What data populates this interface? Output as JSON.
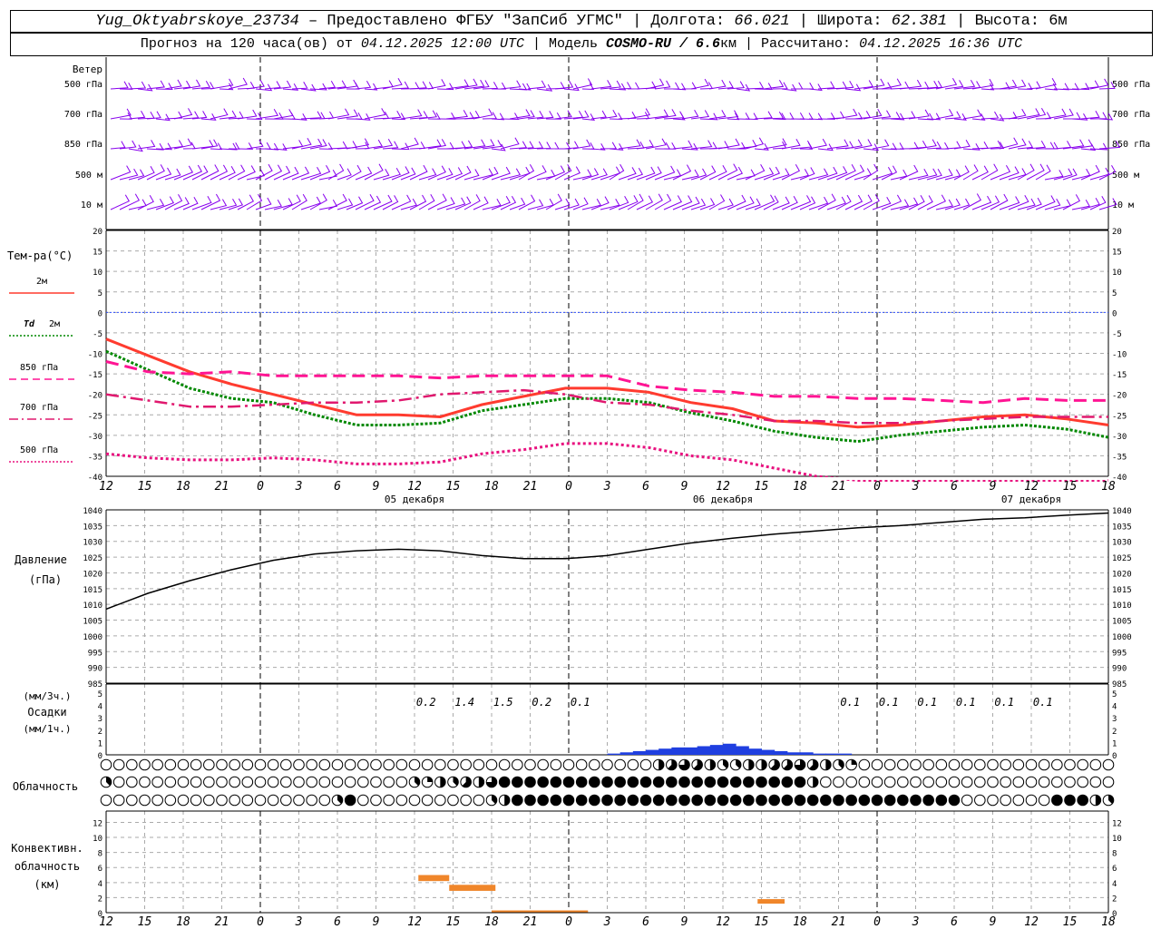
{
  "header": {
    "station": "Yug_Oktyabrskoye_23734",
    "dash": " – ",
    "provided": "Предоставлено ФГБУ \"ЗапСиб УГМС\"",
    "sep": " | ",
    "lon_label": "Долгота: ",
    "lon": "66.021",
    "lat_label": "Широта: ",
    "lat": "62.381",
    "alt_label": "Высота: ",
    "alt": "6м",
    "forecast_label": "Прогноз на 120 часа(ов) от ",
    "forecast_start": "04.12.2025 12:00 UTC",
    "model_label": "Модель ",
    "model": "COSMO-RU / 6.6",
    "model_unit": "км",
    "calc_label": "Рассчитано: ",
    "calc_time": "04.12.2025 16:36 UTC"
  },
  "colors": {
    "t2m": "#ff3b2f",
    "td2m": "#008800",
    "t850": "#ff1493",
    "t700": "#e0186e",
    "t500": "#e8117f",
    "wind": "#8800ee",
    "pressure": "#000000",
    "precip": "#1f3fe0",
    "convective": "#f0862a",
    "zero_line": "#3050ff"
  },
  "time_axis": {
    "hour_labels": [
      "12",
      "15",
      "18",
      "21",
      "0",
      "3",
      "6",
      "9",
      "12",
      "15",
      "18",
      "21",
      "0",
      "3",
      "6",
      "9",
      "12",
      "15",
      "18",
      "21",
      "0",
      "3",
      "6",
      "9",
      "12",
      "15",
      "18"
    ],
    "day_labels": [
      {
        "text": "05 декабря",
        "at_index": 8
      },
      {
        "text": "06 декабря",
        "at_index": 16
      },
      {
        "text": "07 декабря",
        "at_index": 24
      }
    ],
    "midnight_indices": [
      4,
      12,
      20
    ]
  },
  "wind_panel": {
    "title": "Ветер",
    "levels": [
      "500 гПа",
      "700 гПа",
      "850 гПа",
      "500 м",
      "10 м"
    ]
  },
  "temp_panel": {
    "title": "Тем-ра(°C)",
    "legend": [
      {
        "key": "t2m",
        "label": "2м",
        "style": "solid"
      },
      {
        "key": "td2m",
        "label_prefix": "Td",
        "label": "2м",
        "style": "dotted"
      },
      {
        "key": "t850",
        "label": "850 гПа",
        "style": "dashed"
      },
      {
        "key": "t700",
        "label": "700 гПа",
        "style": "dashdot"
      },
      {
        "key": "t500",
        "label": "500 гПа",
        "style": "dotted"
      }
    ],
    "yticks": [
      "20",
      "15",
      "10",
      "5",
      "0",
      "-5",
      "-10",
      "-15",
      "-20",
      "-25",
      "-30",
      "-35",
      "-40"
    ]
  },
  "pressure_panel": {
    "title1": "Давление",
    "title2": "(гПа)",
    "yticks": [
      "1040",
      "1035",
      "1030",
      "1025",
      "1020",
      "1015",
      "1010",
      "1005",
      "1000",
      "995",
      "990",
      "985"
    ]
  },
  "precip_panel": {
    "unit1": "(мм/3ч.)",
    "title": "Осадки",
    "unit2": "(мм/1ч.)",
    "yticks": [
      "5",
      "4",
      "3",
      "2",
      "1",
      "0"
    ],
    "labels": [
      {
        "text": "0.2",
        "at_index": 8.3
      },
      {
        "text": "1.4",
        "at_index": 9.3
      },
      {
        "text": "1.5",
        "at_index": 10.3
      },
      {
        "text": "0.2",
        "at_index": 11.3
      },
      {
        "text": "0.1",
        "at_index": 12.3
      },
      {
        "text": "0.1",
        "at_index": 19.3
      },
      {
        "text": "0.1",
        "at_index": 20.3
      },
      {
        "text": "0.1",
        "at_index": 21.3
      },
      {
        "text": "0.1",
        "at_index": 22.3
      },
      {
        "text": "0.1",
        "at_index": 23.3
      },
      {
        "text": "0.1",
        "at_index": 24.3
      }
    ]
  },
  "cloud_panel": {
    "title": "Облачность"
  },
  "conv_panel": {
    "title1": "Конвективн.",
    "title2": "облачность",
    "title3": "(км)",
    "yticks": [
      "12",
      "10",
      "8",
      "6",
      "4",
      "2",
      "0"
    ]
  },
  "chart_data": {
    "type": "line",
    "x_step_hours": 3,
    "x_start": "04.12.2025 12 UTC",
    "temperature_ylim": [
      -40,
      20
    ],
    "series": [
      {
        "key": "t2m",
        "values": [
          -6.5,
          -10.5,
          -14.5,
          -17.5,
          -20,
          -22.5,
          -25,
          -25,
          -25.5,
          -22.5,
          -20.5,
          -18.5,
          -18.5,
          -19.5,
          -22,
          -23.5,
          -26.5,
          -27,
          -28,
          -27.5,
          -26.5,
          -25.5,
          -25,
          -26,
          -27.5
        ]
      },
      {
        "key": "td2m",
        "values": [
          -9.5,
          -14,
          -18.5,
          -21,
          -22,
          -25,
          -27.5,
          -27.5,
          -27,
          -24,
          -22.5,
          -21,
          -21,
          -22,
          -24.5,
          -26.5,
          -29,
          -30.5,
          -31.5,
          -30,
          -29,
          -28,
          -27.5,
          -28.5,
          -30.5
        ]
      },
      {
        "key": "t850",
        "values": [
          -12,
          -14.5,
          -15,
          -14.5,
          -15.5,
          -15.5,
          -15.5,
          -15.5,
          -16,
          -15.5,
          -15.5,
          -15.5,
          -15.5,
          -18,
          -19,
          -19.5,
          -20.5,
          -20.5,
          -21,
          -21,
          -21.5,
          -22,
          -21,
          -21.5,
          -21.5
        ]
      },
      {
        "key": "t700",
        "values": [
          -20,
          -21.5,
          -23,
          -23,
          -22.5,
          -22,
          -22,
          -21.5,
          -20,
          -19.5,
          -19,
          -20,
          -22,
          -22.5,
          -24,
          -25,
          -26.5,
          -26.5,
          -27,
          -27,
          -26.5,
          -26,
          -25.5,
          -25.5,
          -25.5
        ]
      },
      {
        "key": "t500",
        "values": [
          -34.5,
          -35.5,
          -36,
          -36,
          -35.5,
          -36,
          -37,
          -37,
          -36.5,
          -34.5,
          -33.5,
          -32,
          -32,
          -33,
          -35,
          -36,
          -38,
          -40,
          -41,
          -41,
          -41,
          -41,
          -41,
          -41,
          -41
        ]
      }
    ],
    "pressure_ylim": [
      985,
      1040
    ],
    "pressure": [
      1008.5,
      1013.5,
      1017.5,
      1021,
      1024,
      1026,
      1027,
      1027.5,
      1027,
      1025.5,
      1024.5,
      1024.5,
      1025.5,
      1027.5,
      1029.5,
      1031,
      1032.3,
      1033.3,
      1034.3,
      1035,
      1036,
      1037,
      1037.5,
      1038.3,
      1039
    ],
    "precip_mm_per_hour": [
      0,
      0,
      0,
      0,
      0,
      0,
      0,
      0,
      0,
      0,
      0,
      0,
      0,
      0,
      0,
      0,
      0,
      0,
      0,
      0,
      0,
      0,
      0,
      0,
      0,
      0,
      0,
      0,
      0,
      0,
      0,
      0,
      0,
      0,
      0,
      0,
      0,
      0,
      0,
      0.1,
      0.2,
      0.3,
      0.4,
      0.5,
      0.6,
      0.6,
      0.7,
      0.8,
      0.9,
      0.7,
      0.5,
      0.4,
      0.3,
      0.2,
      0.2,
      0.1,
      0.1,
      0.1,
      0,
      0,
      0,
      0,
      0,
      0,
      0,
      0,
      0,
      0,
      0,
      0,
      0,
      0,
      0,
      0,
      0,
      0,
      0,
      0,
      0,
      0,
      0,
      0,
      0,
      0,
      0,
      0,
      0,
      0,
      0,
      0,
      0,
      0,
      0,
      0,
      0,
      0,
      0,
      0,
      0,
      0,
      0,
      0,
      0,
      0,
      0,
      0.1,
      0.1,
      0.1,
      0,
      0,
      0,
      0,
      0,
      0,
      0,
      0,
      0,
      0,
      0,
      0,
      0,
      0,
      0,
      0,
      0,
      0,
      0,
      0,
      0,
      0,
      0,
      0
    ],
    "convective_km": [
      {
        "start_index": 8.1,
        "end_index": 8.9,
        "top": 5,
        "base": 4.2
      },
      {
        "start_index": 8.9,
        "end_index": 10.1,
        "top": 3.7,
        "base": 2.9
      },
      {
        "start_index": 10,
        "end_index": 12.5,
        "top": 0.3,
        "base": 0.1
      },
      {
        "start_index": 16.9,
        "end_index": 17.6,
        "top": 1.8,
        "base": 1.2
      }
    ],
    "cloud_cover_octas": {
      "high": [
        0,
        0,
        0,
        0,
        0,
        0,
        0,
        0,
        0,
        0,
        0,
        0,
        0,
        0,
        0,
        0,
        0,
        0,
        0,
        0,
        0,
        0,
        0,
        0,
        0,
        0,
        0,
        0,
        0,
        0,
        0,
        0,
        0,
        0,
        0,
        0,
        0,
        0,
        0,
        0,
        0,
        0,
        0,
        4,
        5,
        6,
        5,
        4,
        3,
        3,
        4,
        4,
        5,
        5,
        6,
        5,
        4,
        3,
        2,
        0,
        0,
        0,
        0,
        0,
        0,
        0,
        0,
        0,
        0,
        0,
        0,
        0,
        0,
        0,
        0,
        0,
        0,
        0,
        0,
        0,
        0,
        0,
        0,
        0,
        0,
        0,
        0,
        0,
        0,
        0,
        0,
        0,
        0,
        0,
        0,
        0,
        0,
        0,
        0,
        0,
        0,
        0,
        0,
        0,
        0,
        0,
        0,
        0,
        0,
        0
      ],
      "mid": [
        3,
        0,
        0,
        0,
        0,
        0,
        0,
        0,
        0,
        0,
        0,
        0,
        0,
        0,
        0,
        0,
        0,
        0,
        0,
        0,
        0,
        0,
        0,
        0,
        3,
        2,
        4,
        3,
        5,
        4,
        6,
        8,
        8,
        8,
        8,
        8,
        8,
        8,
        8,
        8,
        8,
        8,
        8,
        8,
        8,
        8,
        8,
        8,
        8,
        8,
        8,
        8,
        8,
        8,
        8,
        4,
        0,
        0,
        0,
        0,
        0,
        0,
        0,
        0,
        0,
        0,
        0,
        0,
        0,
        0,
        0,
        0,
        0,
        0,
        0,
        0,
        0,
        0,
        0,
        0,
        0,
        0,
        0,
        0,
        0,
        0,
        0,
        0,
        0,
        0,
        0,
        0,
        0,
        0,
        0,
        0,
        0,
        0,
        0,
        0,
        0,
        0,
        0,
        0,
        0,
        0,
        0,
        0,
        0,
        0
      ],
      "low": [
        0,
        0,
        0,
        0,
        0,
        0,
        0,
        0,
        0,
        0,
        0,
        0,
        0,
        0,
        0,
        0,
        0,
        0,
        3,
        8,
        0,
        0,
        0,
        0,
        0,
        0,
        0,
        0,
        0,
        0,
        3,
        4,
        8,
        8,
        8,
        8,
        8,
        8,
        8,
        8,
        8,
        8,
        8,
        8,
        8,
        8,
        8,
        8,
        8,
        8,
        8,
        8,
        8,
        8,
        8,
        8,
        8,
        8,
        8,
        8,
        8,
        8,
        8,
        8,
        8,
        8,
        8,
        0,
        0,
        0,
        0,
        0,
        0,
        0,
        8,
        8,
        8,
        4,
        3,
        3,
        4,
        5,
        6,
        3,
        8,
        8,
        8,
        8,
        8,
        8,
        8,
        8,
        8,
        8,
        8,
        8,
        8,
        8,
        8,
        8,
        8,
        8,
        8,
        8,
        8,
        8,
        8,
        8,
        8,
        8
      ]
    }
  }
}
